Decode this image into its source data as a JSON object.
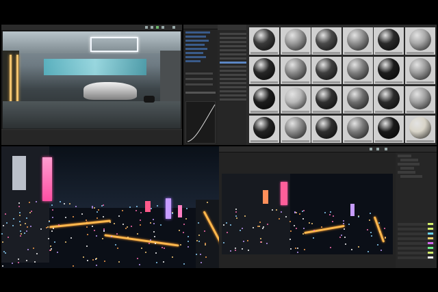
{
  "screens": [
    {
      "name": "interior-render-window"
    },
    {
      "name": "layers-and-curve-panel"
    },
    {
      "name": "material-browser"
    },
    {
      "name": "city-render-window"
    },
    {
      "name": "city-preview-window"
    },
    {
      "name": "properties-panel"
    }
  ],
  "materials": {
    "rows": 4,
    "cols": 6,
    "ball_colors": [
      [
        "#3a3a3a",
        "#9a9a9a",
        "#4a4a4a",
        "#8f8f8f",
        "#2a2a2a",
        "#a8a8a8"
      ],
      [
        "#262626",
        "#8a8a8a",
        "#3f3f3f",
        "#7f7f7f",
        "#1c1c1c",
        "#9c9c9c"
      ],
      [
        "#1c1c1c",
        "#b8b8b8",
        "#303030",
        "#6e6e6e",
        "#2b2b2b",
        "#a0a0a0"
      ],
      [
        "#222222",
        "#8c8c8c",
        "#2e2e2e",
        "#7a7a7a",
        "#191919",
        "#d8d4c8"
      ]
    ]
  },
  "colors": {
    "ui_bg": "#1e1e1e",
    "selection": "#5c86c4",
    "neon_pink": "#ff4fa3",
    "neon_orange": "#ffb84d",
    "glass_cyan": "#57b9c8"
  }
}
